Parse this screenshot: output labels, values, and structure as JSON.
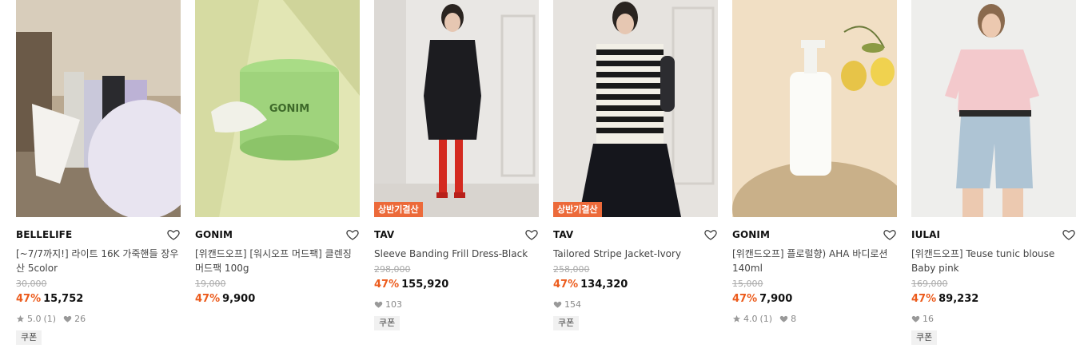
{
  "products": [
    {
      "brand": "BELLELIFE",
      "name": "[~7/7까지!] 라이트 16K 가죽핸들 장우산 5color",
      "original_price": "30,000",
      "discount": "47%",
      "price": "15,752",
      "rating": "5.0",
      "review_count": "(1)",
      "likes": "26",
      "tag": "",
      "coupon": "쿠폰",
      "image_icon": "umbrella-photo"
    },
    {
      "brand": "GONIM",
      "name": "[위캔드오프] [워시오프 머드팩] 클렌징 머드팩 100g",
      "original_price": "19,000",
      "discount": "47%",
      "price": "9,900",
      "rating": "",
      "review_count": "",
      "likes": "",
      "tag": "",
      "coupon": "",
      "image_icon": "mud-pack-jar-photo"
    },
    {
      "brand": "TAV",
      "name": "Sleeve Banding Frill Dress-Black",
      "original_price": "298,000",
      "discount": "47%",
      "price": "155,920",
      "rating": "",
      "review_count": "",
      "likes": "103",
      "tag": "상반기결산",
      "coupon": "쿠폰",
      "image_icon": "black-dress-photo"
    },
    {
      "brand": "TAV",
      "name": "Tailored Stripe Jacket-Ivory",
      "original_price": "258,000",
      "discount": "47%",
      "price": "134,320",
      "rating": "",
      "review_count": "",
      "likes": "154",
      "tag": "상반기결산",
      "coupon": "쿠폰",
      "image_icon": "stripe-jacket-photo"
    },
    {
      "brand": "GONIM",
      "name": "[위캔드오프] 플로럴향) AHA 바디로션 140ml",
      "original_price": "15,000",
      "discount": "47%",
      "price": "7,900",
      "rating": "4.0",
      "review_count": "(1)",
      "likes": "8",
      "tag": "",
      "coupon": "",
      "image_icon": "body-lotion-photo"
    },
    {
      "brand": "IULAI",
      "name": "[위캔드오프] Teuse tunic blouse Baby pink",
      "original_price": "169,000",
      "discount": "47%",
      "price": "89,232",
      "rating": "",
      "review_count": "",
      "likes": "16",
      "tag": "",
      "coupon": "쿠폰",
      "image_icon": "pink-blouse-photo"
    }
  ],
  "colors": {
    "discount": "#ec5b1c",
    "tag_bg": "#ec6a3a"
  }
}
